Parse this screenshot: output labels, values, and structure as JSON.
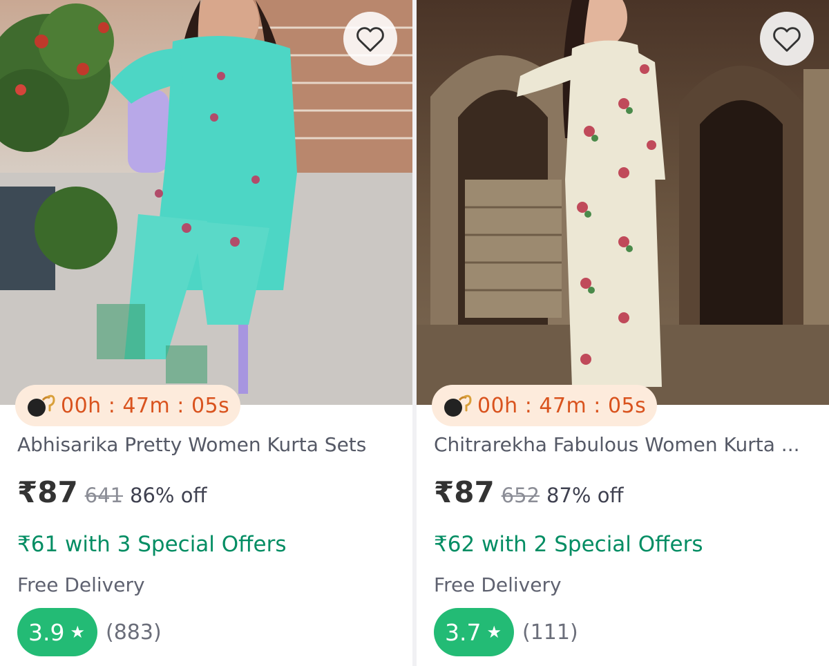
{
  "products": [
    {
      "name": "Abhisarika Pretty Women Kurta Sets",
      "image_alt": "",
      "wishlist_icon": "heart-icon",
      "timer": "00h : 47m : 05s",
      "timer_icon": "bomb-icon",
      "price": "₹87",
      "mrp": "641",
      "discount": "86% off",
      "special_offer": "₹61 with 3 Special Offers",
      "delivery": "Free Delivery",
      "rating": "3.9",
      "rating_icon": "star-icon",
      "rating_count": "(883)"
    },
    {
      "name": "Chitrarekha Fabulous Women Kurta ...",
      "image_alt": "",
      "wishlist_icon": "heart-icon",
      "timer": "00h : 47m : 05s",
      "timer_icon": "bomb-icon",
      "price": "₹87",
      "mrp": "652",
      "discount": "87% off",
      "special_offer": "₹62 with 2 Special Offers",
      "delivery": "Free Delivery",
      "rating": "3.7",
      "rating_icon": "star-icon",
      "rating_count": "(111)"
    }
  ],
  "colors": {
    "offer_green": "#038d63",
    "rating_green": "#23bb75",
    "timer_orange": "#d9531e",
    "timer_bg": "#fdebdc"
  }
}
